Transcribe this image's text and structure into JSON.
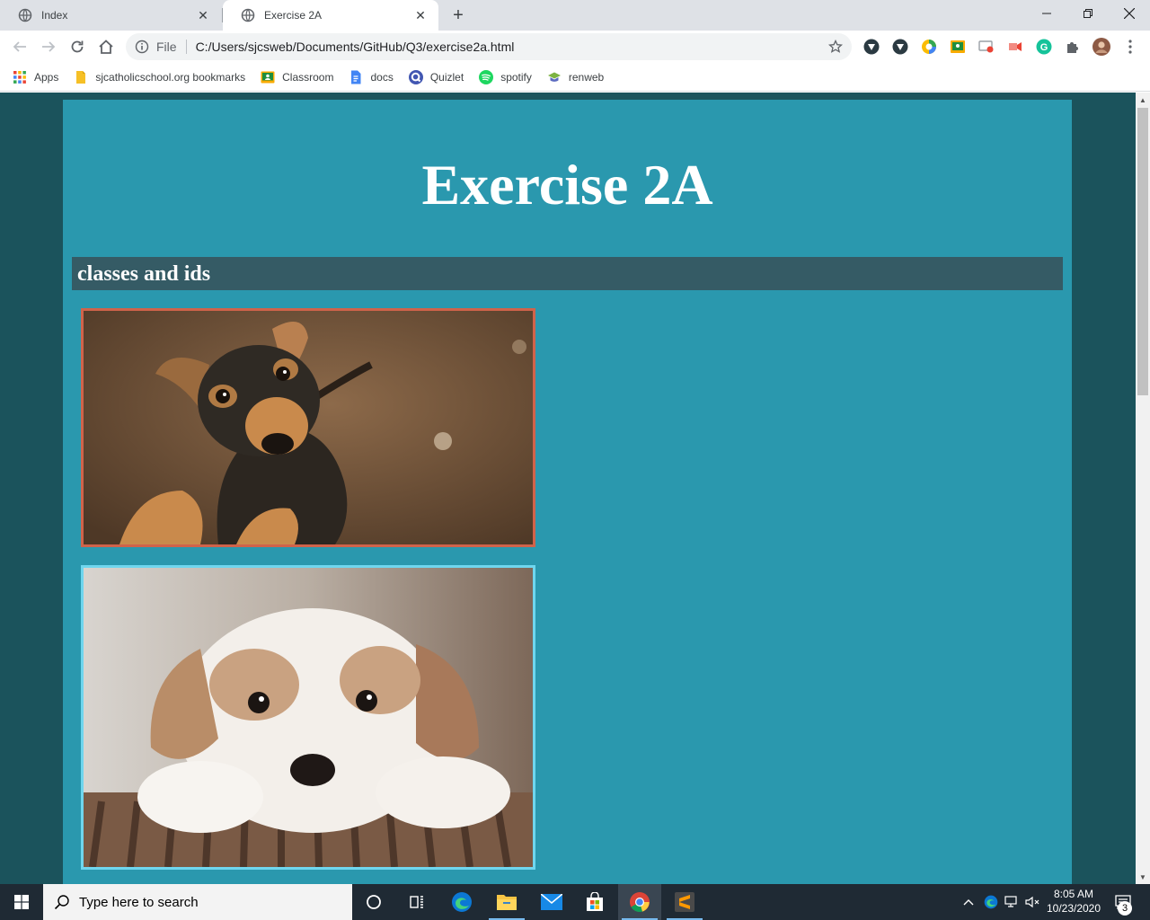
{
  "browser": {
    "tabs": [
      {
        "title": "Index",
        "icon": "globe-icon",
        "active": false
      },
      {
        "title": "Exercise 2A",
        "icon": "globe-icon",
        "active": true
      }
    ],
    "new_tab_label": "+",
    "url_prefix": "File",
    "url": "C:/Users/sjcsweb/Documents/GitHub/Q3/exercise2a.html",
    "bookmarks": [
      {
        "label": "Apps",
        "icon": "apps-grid-icon"
      },
      {
        "label": "sjcatholicschool.org bookmarks",
        "icon": "folder-icon"
      },
      {
        "label": "Classroom",
        "icon": "classroom-icon"
      },
      {
        "label": "docs",
        "icon": "docs-icon"
      },
      {
        "label": "Quizlet",
        "icon": "quizlet-icon"
      },
      {
        "label": "spotify",
        "icon": "spotify-icon"
      },
      {
        "label": "renweb",
        "icon": "renweb-icon"
      }
    ]
  },
  "page": {
    "title": "Exercise 2A",
    "section_title": "classes and ids",
    "images": [
      {
        "name": "puppy-photo-brown-black",
        "border_color": "#d0634a"
      },
      {
        "name": "puppy-photo-white-tan",
        "border_color": "#6fd6ee"
      }
    ],
    "colors": {
      "outer_background": "#1b535c",
      "container_background": "#2a98ae",
      "section_bar": "#355b65"
    }
  },
  "taskbar": {
    "search_placeholder": "Type here to search",
    "time": "8:05 AM",
    "date": "10/23/2020",
    "notification_count": "3"
  }
}
